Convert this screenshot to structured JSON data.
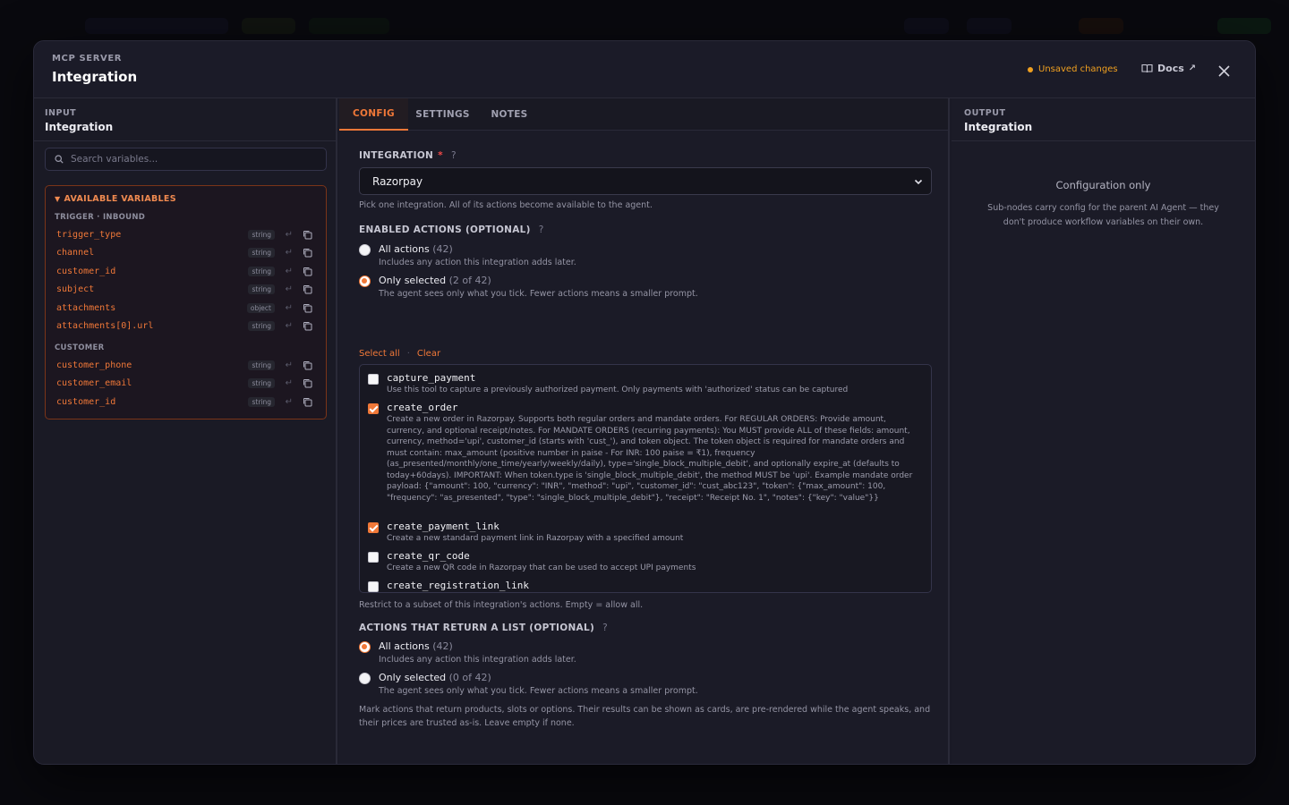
{
  "modal": {
    "kicker": "MCP SERVER",
    "title": "Integration",
    "unsaved": "Unsaved changes",
    "docs": "Docs",
    "docs_arrow": "↗"
  },
  "input_panel": {
    "kicker": "INPUT",
    "title": "Integration",
    "search_placeholder": "Search variables...",
    "vars_title": "AVAILABLE VARIABLES",
    "groups": [
      {
        "name": "TRIGGER · INBOUND",
        "vars": [
          {
            "name": "trigger_type",
            "type": "string"
          },
          {
            "name": "channel",
            "type": "string"
          },
          {
            "name": "customer_id",
            "type": "string"
          },
          {
            "name": "subject",
            "type": "string"
          },
          {
            "name": "attachments",
            "type": "object"
          },
          {
            "name": "attachments[0].url",
            "type": "string"
          }
        ]
      },
      {
        "name": "CUSTOMER",
        "vars": [
          {
            "name": "customer_phone",
            "type": "string"
          },
          {
            "name": "customer_email",
            "type": "string"
          },
          {
            "name": "customer_id",
            "type": "string"
          }
        ]
      }
    ]
  },
  "tabs": [
    {
      "label": "CONFIG",
      "active": true
    },
    {
      "label": "SETTINGS",
      "active": false
    },
    {
      "label": "NOTES",
      "active": false
    }
  ],
  "config": {
    "integration_label": "INTEGRATION",
    "required_mark": "*",
    "help_mark": "?",
    "integration_value": "Razorpay",
    "integration_hint": "Pick one integration. All of its actions become available to the agent.",
    "enabled_label": "ENABLED ACTIONS (OPTIONAL)",
    "enabled_options": [
      {
        "label": "All actions",
        "count": "(42)",
        "desc": "Includes any action this integration adds later.",
        "selected": false
      },
      {
        "label": "Only selected",
        "count": "(2 of 42)",
        "desc": "The agent sees only what you tick. Fewer actions means a smaller prompt.",
        "selected": true
      }
    ],
    "select_all": "Select all",
    "dot_sep": "·",
    "clear": "Clear",
    "actions": [
      {
        "name": "capture_payment",
        "checked": false,
        "desc": "Use this tool to capture a previously authorized payment. Only payments with 'authorized' status can be captured"
      },
      {
        "name": "create_order",
        "checked": true,
        "desc": "Create a new order in Razorpay. Supports both regular orders and mandate orders. For REGULAR ORDERS: Provide amount, currency, and optional receipt/notes. For MANDATE ORDERS (recurring payments): You MUST provide ALL of these fields: amount, currency, method='upi', customer_id (starts with 'cust_'), and token object. The token object is required for mandate orders and must contain: max_amount (positive number in paise - For INR: 100 paise = ₹1), frequency (as_presented/monthly/one_time/yearly/weekly/daily), type='single_block_multiple_debit', and optionally expire_at (defaults to today+60days). IMPORTANT: When token.type is 'single_block_multiple_debit', the method MUST be 'upi'. Example mandate order payload: {\"amount\": 100, \"currency\": \"INR\", \"method\": \"upi\", \"customer_id\": \"cust_abc123\", \"token\": {\"max_amount\": 100, \"frequency\": \"as_presented\", \"type\": \"single_block_multiple_debit\"}, \"receipt\": \"Receipt No. 1\", \"notes\": {\"key\": \"value\"}}"
      },
      {
        "name": "create_payment_link",
        "checked": true,
        "desc": "Create a new standard payment link in Razorpay with a specified amount"
      },
      {
        "name": "create_qr_code",
        "checked": false,
        "desc": "Create a new QR code in Razorpay that can be used to accept UPI payments"
      },
      {
        "name": "create_registration_link",
        "checked": false,
        "desc": ""
      }
    ],
    "actions_hint": "Restrict to a subset of this integration's actions. Empty = allow all.",
    "list_label": "ACTIONS THAT RETURN A LIST (OPTIONAL)",
    "list_options": [
      {
        "label": "All actions",
        "count": "(42)",
        "desc": "Includes any action this integration adds later.",
        "selected": true
      },
      {
        "label": "Only selected",
        "count": "(0 of 42)",
        "desc": "The agent sees only what you tick. Fewer actions means a smaller prompt.",
        "selected": false
      }
    ],
    "list_note": "Mark actions that return products, slots or options. Their results can be shown as cards, are pre-rendered while the agent speaks, and their prices are trusted as-is. Leave empty if none."
  },
  "output_panel": {
    "kicker": "OUTPUT",
    "title": "Integration",
    "config_title": "Configuration only",
    "config_desc": "Sub-nodes carry config for the parent AI Agent — they don't produce workflow variables on their own."
  },
  "colors": {
    "accent": "#f07838",
    "warning": "#f0a020",
    "required": "#f04848"
  }
}
